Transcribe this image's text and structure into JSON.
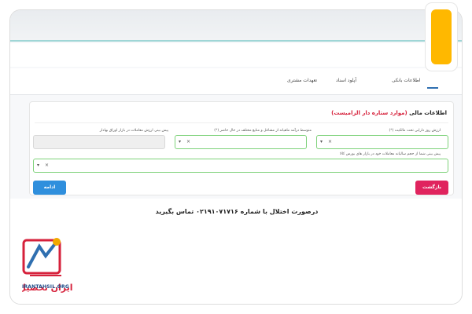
{
  "tabs": [
    {
      "label": "اطلاعات بانکی"
    },
    {
      "label": "آپلود اسناد"
    },
    {
      "label": "تعهدات مشتری"
    }
  ],
  "section": {
    "title": "اطلاعات مالی",
    "title_note": "(موارد ستاره دار الزامیست)"
  },
  "fields": {
    "asset_value": {
      "label": "ارزش روز دارایی تحت مالکیت (*)"
    },
    "avg_income": {
      "label": "متوسط درآمد ماهیانه از مشاغل و منابع مختلف در حال حاضر (*)"
    },
    "forecast_trades": {
      "label": "پیش بینی ارزش معاملات در بازار اوراق بهادار"
    },
    "experience": {
      "label": "پیش بینی شما از حجم سالیانه معاملات خود در بازار های بورس کالا"
    }
  },
  "select": {
    "arrow": "▾",
    "clear": "×"
  },
  "buttons": {
    "back": "بازگشت",
    "next": "ادامه"
  },
  "footer": {
    "contact": "درصورت اختلال با شماره ۰۲۱۹۱۰۷۱۷۱۶ تماس بگیرید"
  },
  "logo": {
    "brand": "ایران تحصیل",
    "url": "IRANTAHSIL.ORG"
  },
  "colors": {
    "accent": "#ffb800",
    "primary": "#2f8fdd",
    "danger": "#e0245e",
    "valid": "#7ed27a"
  }
}
